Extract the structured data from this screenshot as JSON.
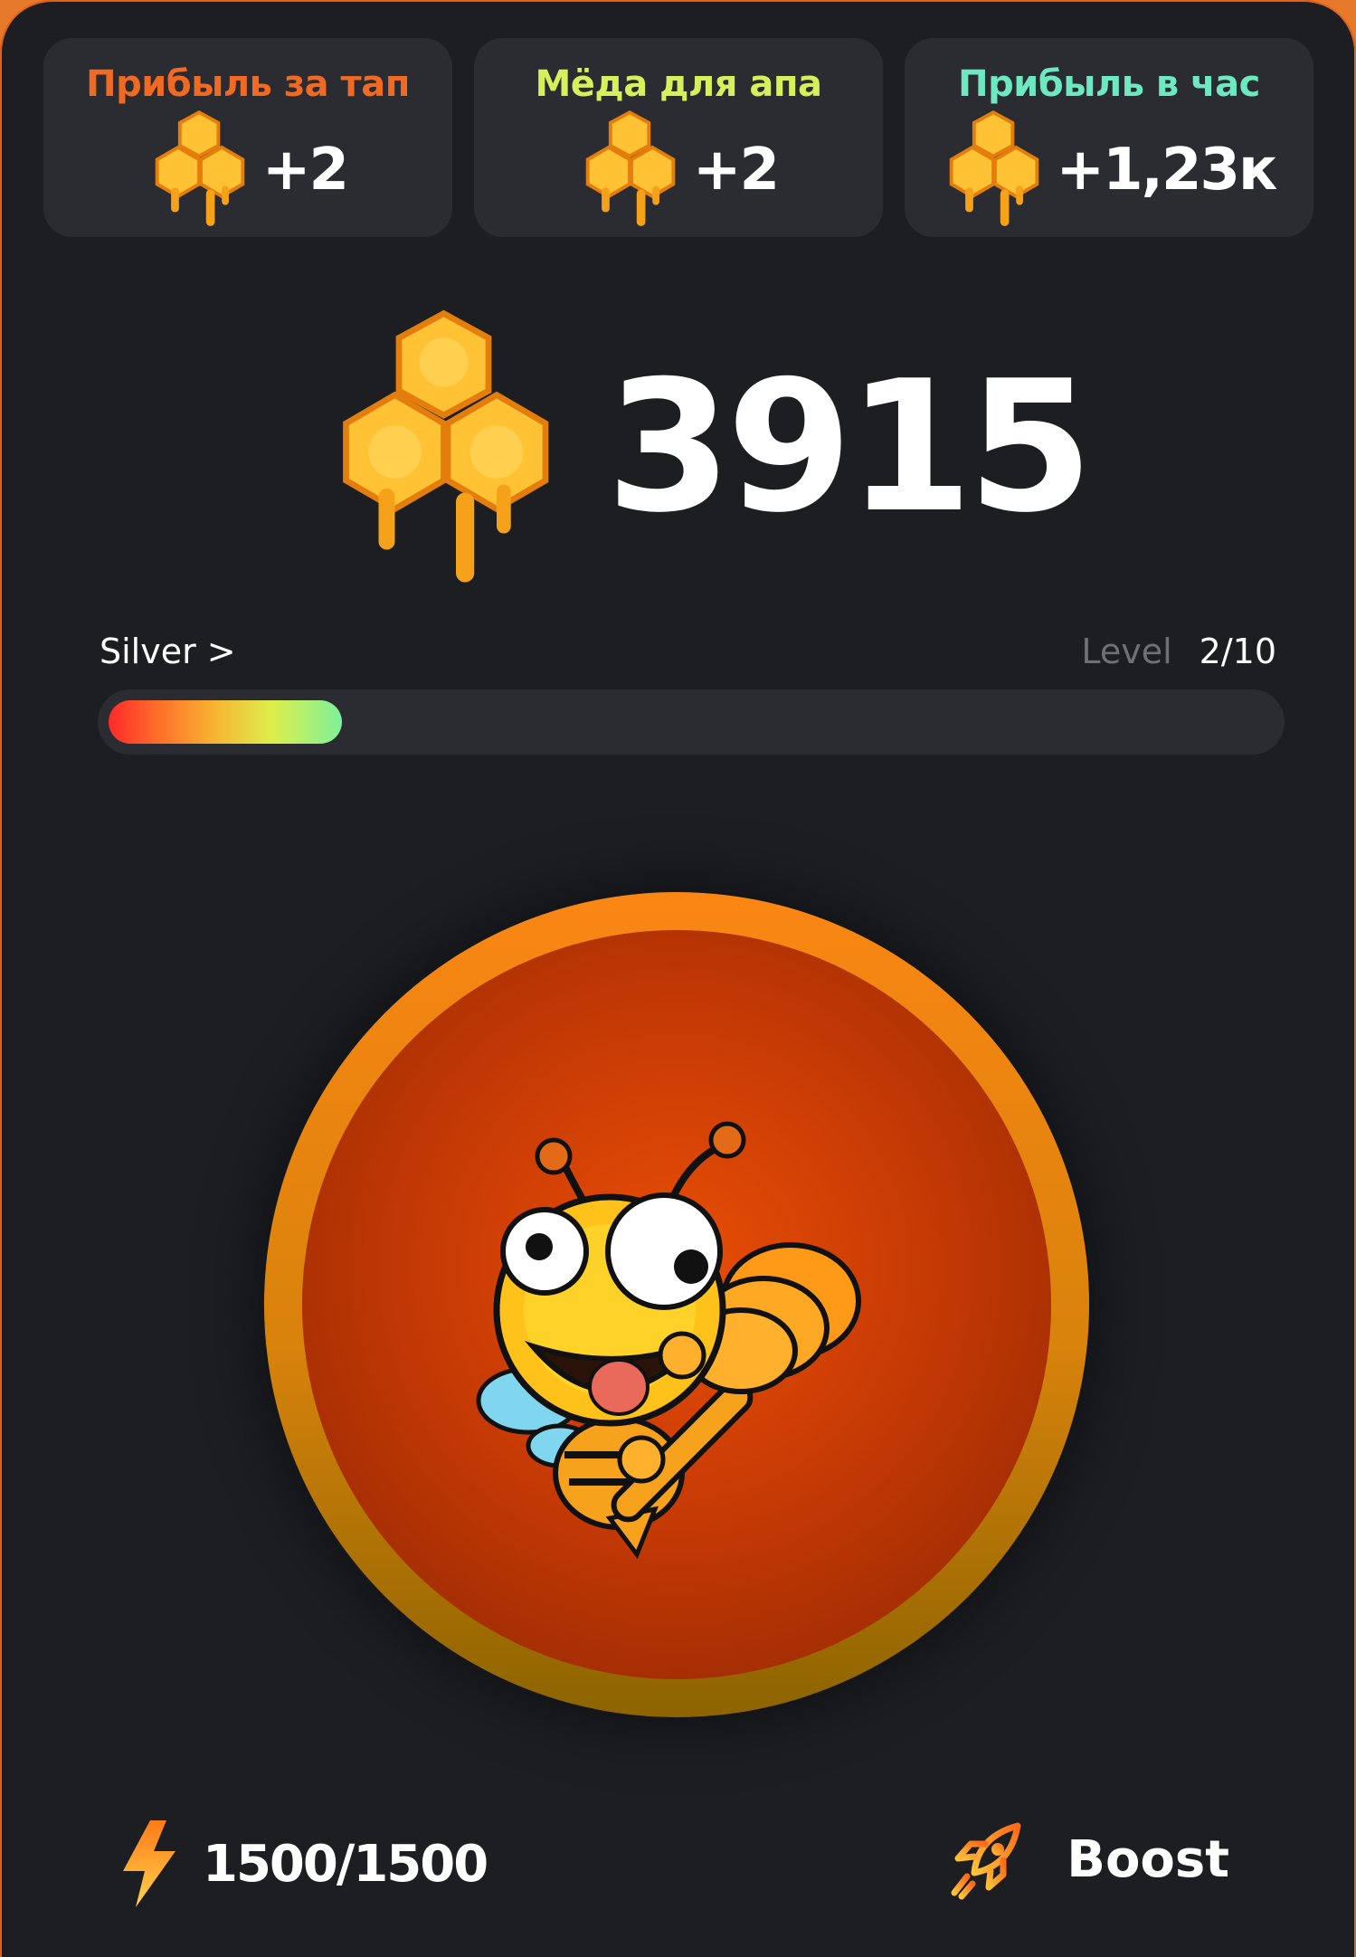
{
  "stats": [
    {
      "title": "Прибыль за тап",
      "value": "+2",
      "color": "#f06a24"
    },
    {
      "title": "Мёда для апа",
      "value": "+2",
      "color": "#d6ef5a"
    },
    {
      "title": "Прибыль в час",
      "value": "+1,23к",
      "color": "#6ee8c0"
    }
  ],
  "balance": {
    "value": "3915",
    "icon": "honeycomb-icon"
  },
  "level": {
    "rank_link": "Silver >",
    "label": "Level",
    "value": "2/10",
    "progress": 0.2
  },
  "tap": {
    "character": "bee-mascot"
  },
  "energy": {
    "value": "1500/1500",
    "icon": "lightning-icon"
  },
  "boost": {
    "label": "Boost",
    "icon": "rocket-icon"
  },
  "colors": {
    "background": "#1c1e22",
    "card": "#2a2c31",
    "accent": "#fb8614"
  }
}
